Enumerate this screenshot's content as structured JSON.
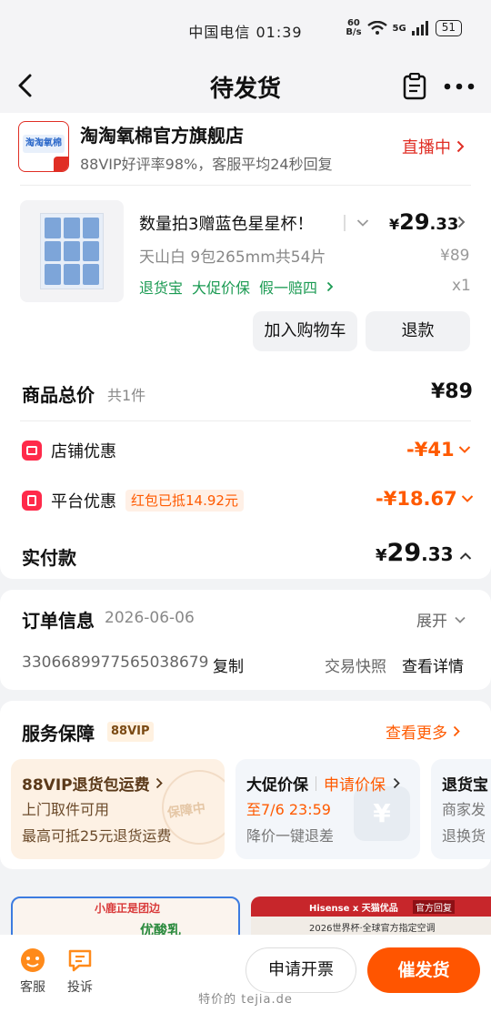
{
  "status_bar": {
    "carrier_time": "中国电信 01:39",
    "net_speed_top": "60",
    "net_speed_bottom": "B/s",
    "signal": "5G",
    "battery": "51"
  },
  "nav": {
    "title": "待发货"
  },
  "shop": {
    "logo_text": "淘淘氧棉",
    "name": "淘淘氧棉官方旗舰店",
    "subtitle": "88VIP好评率98%，客服平均24秒回复",
    "live_label": "直播中"
  },
  "product": {
    "title": "数量拍3赠蓝色星星杯！",
    "spec": "天山白 9包265mm共54片",
    "tags": [
      "退货宝",
      "大促价保",
      "假一赔四"
    ],
    "price_symbol": "¥",
    "price_int": "29",
    "price_dec": ".33",
    "original_price": "¥89",
    "quantity": "x1"
  },
  "product_actions": {
    "add_cart": "加入购物车",
    "refund": "退款"
  },
  "summary": {
    "total_label": "商品总价",
    "total_count": "共1件",
    "total_value": "¥89",
    "shop_discount_label": "店铺优惠",
    "shop_discount_value": "-¥41",
    "platform_discount_label": "平台优惠",
    "platform_discount_badge": "红包已抵14.92元",
    "platform_discount_value": "-¥18.67",
    "paid_label": "实付款",
    "paid_symbol": "¥",
    "paid_int": "29",
    "paid_dec": ".33"
  },
  "order_info": {
    "label": "订单信息",
    "date": "2026-06-06",
    "expand": "展开",
    "order_no": "3306689977565038679",
    "copy": "复制",
    "snapshot": "交易快照",
    "details": "查看详情"
  },
  "service": {
    "label": "服务保障",
    "badge": "88VIP",
    "more": "查看更多",
    "cards": [
      {
        "title": "88VIP退货包运费",
        "line1": "上门取件可用",
        "line2": "最高可抵25元退货运费",
        "stamp": "保障中"
      },
      {
        "title": "大促价保",
        "action": "申请价保",
        "line1": "至7/6 23:59",
        "line2": "降价一键退差"
      },
      {
        "title": "退货宝",
        "line1": "商家发",
        "line2": "退换货"
      }
    ]
  },
  "ads": {
    "left_text": "小鹿正是团边",
    "left_brand": "优酸乳",
    "right_brand": "Hisense x 天猫优品",
    "right_tag": "官方回复",
    "right_text": "2026世界杯·全球官方指定空调"
  },
  "bottom_bar": {
    "service": "客服",
    "complain": "投诉",
    "invoice": "申请开票",
    "urge": "催发货",
    "watermark": "特价的  tejia.de"
  },
  "colors": {
    "accent_orange": "#ff5a00",
    "live_red": "#e02e24",
    "green_tag": "#1a9a52"
  }
}
